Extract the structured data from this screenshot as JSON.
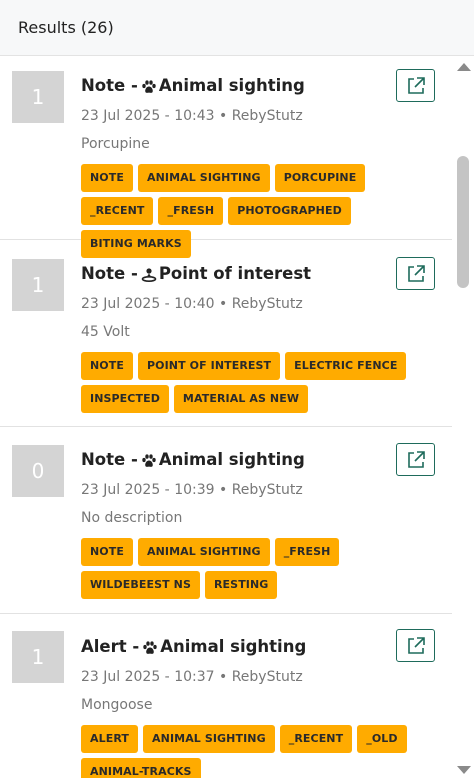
{
  "header": {
    "title": "Results (26)"
  },
  "results": [
    {
      "count": "1",
      "category": "Note -",
      "type_icon": "paw-icon",
      "type": "Animal sighting",
      "meta": "23 Jul 2025 - 10:43 • RebyStutz",
      "description": "Porcupine",
      "tags": [
        "NOTE",
        "ANIMAL SIGHTING",
        "PORCUPINE",
        "_RECENT",
        "_FRESH",
        "PHOTOGRAPHED",
        "BITING MARKS"
      ]
    },
    {
      "count": "1",
      "category": "Note -",
      "type_icon": "point-of-interest-icon",
      "type": "Point of interest",
      "meta": "23 Jul 2025 - 10:40 • RebyStutz",
      "description": "45 Volt",
      "tags": [
        "NOTE",
        "POINT OF INTEREST",
        "ELECTRIC FENCE",
        "INSPECTED",
        "MATERIAL AS NEW"
      ]
    },
    {
      "count": "0",
      "category": "Note -",
      "type_icon": "paw-icon",
      "type": "Animal sighting",
      "meta": "23 Jul 2025 - 10:39 • RebyStutz",
      "description": "No description",
      "tags": [
        "NOTE",
        "ANIMAL SIGHTING",
        "_FRESH",
        "WILDEBEEST NS",
        "RESTING"
      ]
    },
    {
      "count": "1",
      "category": "Alert -",
      "type_icon": "paw-icon",
      "type": "Animal sighting",
      "meta": "23 Jul 2025 - 10:37 • RebyStutz",
      "description": "Mongoose",
      "tags": [
        "ALERT",
        "ANIMAL SIGHTING",
        "_RECENT",
        "_OLD",
        "ANIMAL-TRACKS"
      ]
    }
  ],
  "colors": {
    "tag": "#ffab00",
    "accent": "#1e6b5b",
    "count_box": "#d4d4d4"
  }
}
